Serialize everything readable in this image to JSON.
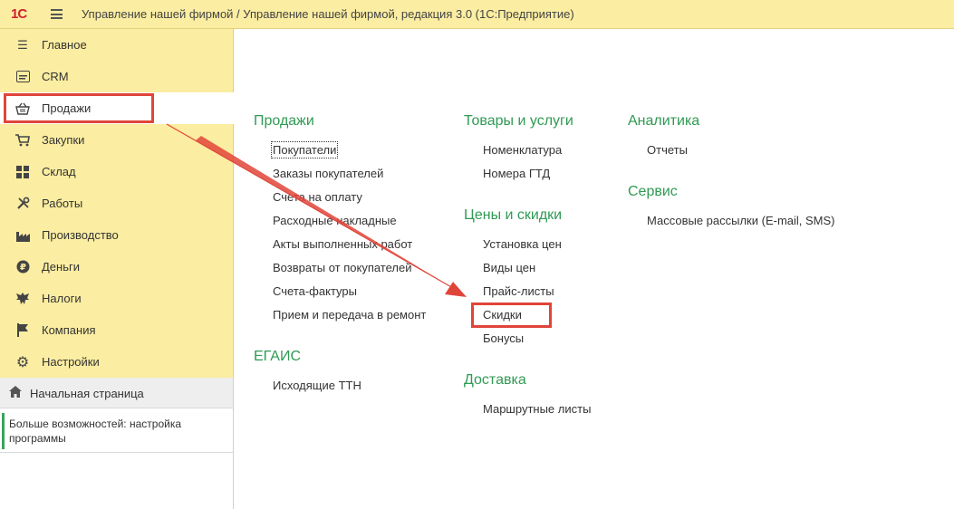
{
  "app": {
    "logo": "1С",
    "title": "Управление нашей фирмой / Управление нашей фирмой, редакция 3.0  (1С:Предприятие)"
  },
  "sidebar": {
    "items": [
      {
        "label": "Главное",
        "icon": "list-icon"
      },
      {
        "label": "CRM",
        "icon": "id-card-icon"
      },
      {
        "label": "Продажи",
        "icon": "basket-icon",
        "active": true
      },
      {
        "label": "Закупки",
        "icon": "cart-icon"
      },
      {
        "label": "Склад",
        "icon": "grid-icon"
      },
      {
        "label": "Работы",
        "icon": "tools-icon"
      },
      {
        "label": "Производство",
        "icon": "factory-icon"
      },
      {
        "label": "Деньги",
        "icon": "ruble-icon"
      },
      {
        "label": "Налоги",
        "icon": "eagle-icon"
      },
      {
        "label": "Компания",
        "icon": "flag-icon"
      },
      {
        "label": "Настройки",
        "icon": "gear-icon"
      }
    ],
    "home": {
      "label": "Начальная страница",
      "icon": "home-icon"
    },
    "more": {
      "label": "Больше возможностей: настройка программы"
    }
  },
  "sections": {
    "sales": {
      "title": "Продажи",
      "links": [
        "Покупатели",
        "Заказы покупателей",
        "Счета на оплату",
        "Расходные накладные",
        "Акты выполненных работ",
        "Возвраты от покупателей",
        "Счета-фактуры",
        "Прием и передача в ремонт"
      ]
    },
    "egais": {
      "title": "ЕГАИС",
      "links": [
        "Исходящие ТТН"
      ]
    },
    "goods": {
      "title": "Товары и услуги",
      "links": [
        "Номенклатура",
        "Номера ГТД"
      ]
    },
    "prices": {
      "title": "Цены и скидки",
      "links": [
        "Установка цен",
        "Виды цен",
        "Прайс-листы",
        "Скидки",
        "Бонусы"
      ]
    },
    "delivery": {
      "title": "Доставка",
      "links": [
        "Маршрутные листы"
      ]
    },
    "analytics": {
      "title": "Аналитика",
      "links": [
        "Отчеты"
      ]
    },
    "service": {
      "title": "Сервис",
      "links": [
        "Массовые рассылки (E-mail, SMS)"
      ]
    }
  },
  "colors": {
    "accent_green": "#2f9a53",
    "header_yellow": "#fbeda1",
    "highlight_red": "#e0453a"
  }
}
